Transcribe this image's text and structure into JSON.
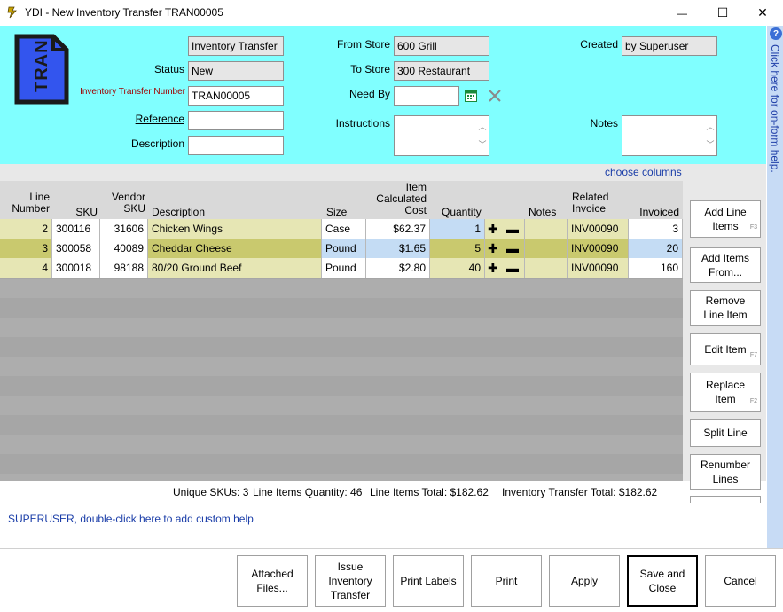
{
  "window": {
    "title": "YDI - New Inventory Transfer TRAN00005",
    "minimize": "—",
    "maximize": "☐",
    "close": "✕"
  },
  "header": {
    "doc_icon_text": "TRAN",
    "type_value": "Inventory Transfer",
    "status_label": "Status",
    "status_value": "New",
    "number_label": "Inventory Transfer Number",
    "number_value": "TRAN00005",
    "reference_label": "Reference",
    "reference_value": "",
    "description_label": "Description",
    "description_value": "",
    "from_store_label": "From Store",
    "from_store_value": "600 Grill",
    "to_store_label": "To Store",
    "to_store_value": "300 Restaurant",
    "need_by_label": "Need By",
    "need_by_value": "",
    "instructions_label": "Instructions",
    "instructions_value": "",
    "created_label": "Created",
    "created_value": "by Superuser",
    "notes_label": "Notes",
    "notes_value": ""
  },
  "help_strip": {
    "icon": "?",
    "text": "Click here for on-form help."
  },
  "grid": {
    "choose_columns": "choose columns",
    "columns": {
      "line_number": [
        "Line",
        "Number"
      ],
      "sku": [
        "SKU"
      ],
      "vendor_sku": [
        "Vendor",
        "SKU"
      ],
      "description": [
        "Description"
      ],
      "size": [
        "Size"
      ],
      "item_cost": [
        "Item",
        "Calculated",
        "Cost"
      ],
      "quantity": [
        "Quantity"
      ],
      "notes": [
        "Notes"
      ],
      "related_invoice": [
        "Related",
        "Invoice"
      ],
      "invoiced": [
        "Invoiced"
      ]
    },
    "rows": [
      {
        "line": "2",
        "sku": "300116",
        "vendor_sku": "31606",
        "description": "Chicken Wings",
        "size": "Case",
        "cost": "$62.37",
        "quantity": "1",
        "notes": "",
        "invoice": "INV00090",
        "invoiced": "3"
      },
      {
        "line": "3",
        "sku": "300058",
        "vendor_sku": "40089",
        "description": "Cheddar Cheese",
        "size": "Pound",
        "cost": "$1.65",
        "quantity": "5",
        "notes": "",
        "invoice": "INV00090",
        "invoiced": "20"
      },
      {
        "line": "4",
        "sku": "300018",
        "vendor_sku": "98188",
        "description": "80/20 Ground Beef",
        "size": "Pound",
        "cost": "$2.80",
        "quantity": "40",
        "notes": "",
        "invoice": "INV00090",
        "invoiced": "160"
      }
    ]
  },
  "side_buttons": {
    "add_line_items": "Add Line Items",
    "add_line_items_key": "F3",
    "add_items_from": "Add Items From...",
    "remove_line_item": "Remove Line Item",
    "edit_item": "Edit Item",
    "edit_item_key": "F7",
    "replace_item": "Replace Item",
    "replace_item_key": "F2",
    "split_line": "Split Line",
    "renumber_lines": "Renumber Lines"
  },
  "summary": {
    "unique_skus": "Unique SKUs: 3",
    "line_items_quantity": "Line Items Quantity: 46",
    "line_items_total": "Line Items Total: $182.62",
    "transfer_total": "Inventory Transfer Total: $182.62"
  },
  "custom_help": "SUPERUSER, double-click here to add custom help",
  "bottom_buttons": {
    "attached_files": "Attached Files...",
    "issue_transfer": "Issue Inventory Transfer",
    "print_labels": "Print Labels",
    "print": "Print",
    "apply": "Apply",
    "save_close": "Save and Close",
    "cancel": "Cancel"
  },
  "colors": {
    "header_bg": "#80ffff",
    "row_light": "#e6e6b4",
    "row_selected": "#c9c96e",
    "grid_empty": "#a6a6a6",
    "link": "#1a3da8",
    "doc_icon": "#3355ee"
  }
}
